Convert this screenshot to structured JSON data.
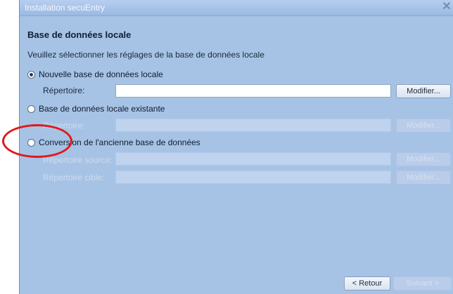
{
  "window": {
    "title": "Installation secuEntry",
    "close_label": "✕"
  },
  "page": {
    "heading": "Base de données locale",
    "description": "Veuillez sélectionner les réglages de la base de données locale"
  },
  "options": [
    {
      "label": "Nouvelle base de données locale",
      "selected": true,
      "fields": [
        {
          "label": "Répertoire:",
          "value": "",
          "button": "Modifier...",
          "enabled": true
        }
      ]
    },
    {
      "label": "Base de données locale existante",
      "selected": false,
      "fields": [
        {
          "label": "Répertoire:",
          "value": "",
          "button": "Modifier...",
          "enabled": false
        }
      ]
    },
    {
      "label": "Conversion de l'ancienne base de données",
      "selected": false,
      "fields": [
        {
          "label": "Répertoire source:",
          "value": "",
          "button": "Modifier...",
          "enabled": false
        },
        {
          "label": "Répertoire cible:",
          "value": "",
          "button": "Modifier...",
          "enabled": false
        }
      ]
    }
  ],
  "footer": {
    "back_label": "< Retour",
    "next_label": "Suivant >"
  },
  "annotation": {
    "color": "#e0191b"
  }
}
